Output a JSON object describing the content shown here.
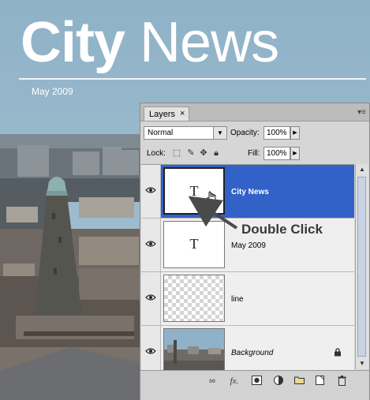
{
  "poster": {
    "title_city": "City",
    "title_news": "News",
    "date": "May 2009"
  },
  "layers_panel": {
    "tab_label": "Layers",
    "tab_close": "×",
    "blend_mode": "Normal",
    "opacity_label": "Opacity:",
    "opacity_value": "100%",
    "lock_label": "Lock:",
    "fill_label": "Fill:",
    "fill_value": "100%",
    "layers": [
      {
        "name": "City News",
        "kind": "text",
        "thumb_glyph": "T",
        "selected": true,
        "visible": true
      },
      {
        "name": "May 2009",
        "kind": "text",
        "thumb_glyph": "T",
        "selected": false,
        "visible": true
      },
      {
        "name": "line",
        "kind": "transparent",
        "selected": false,
        "visible": true
      },
      {
        "name": "Background",
        "kind": "image",
        "selected": false,
        "visible": true,
        "locked": true
      }
    ],
    "bottom_icons": [
      "link-layers-icon",
      "fx-icon",
      "add-mask-icon",
      "adjustment-layer-icon",
      "new-group-icon",
      "new-layer-icon",
      "trash-icon"
    ],
    "fx_label": "fx."
  },
  "annotation": {
    "callout": "Double Click"
  },
  "colors": {
    "selection": "#3262c8",
    "sky": "#9ab8cc",
    "panel_bg": "#d6d6d6"
  }
}
